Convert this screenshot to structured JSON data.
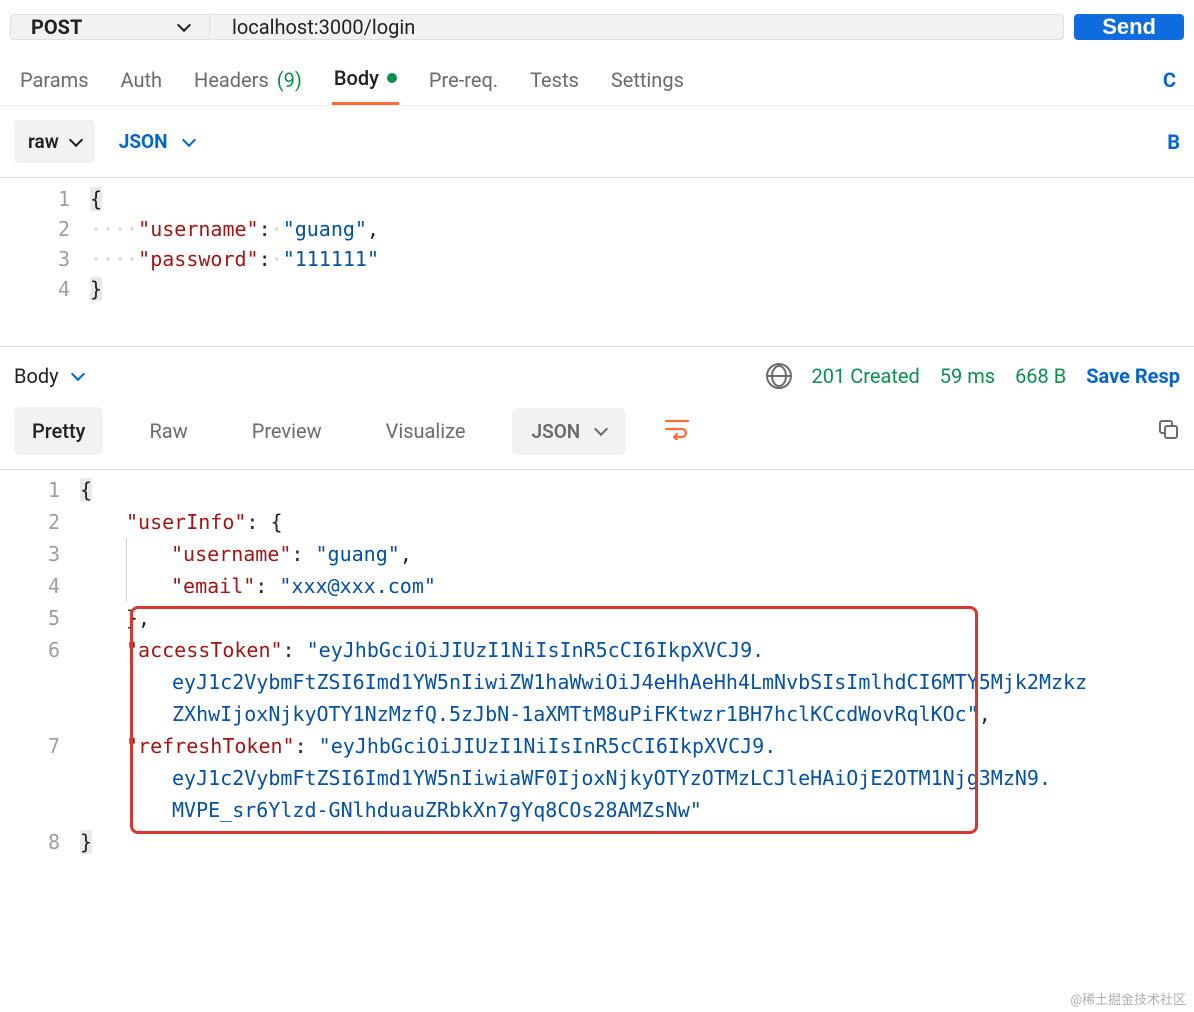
{
  "request": {
    "method": "POST",
    "url": "localhost:3000/login",
    "send_label": "Send"
  },
  "tabs": {
    "params": "Params",
    "auth": "Auth",
    "headers": "Headers",
    "headers_count": "(9)",
    "body": "Body",
    "prerequest": "Pre-req.",
    "tests": "Tests",
    "settings": "Settings",
    "right_link": "C"
  },
  "body_settings": {
    "mode": "raw",
    "content_type": "JSON",
    "right_link": "B"
  },
  "request_body_lines": [
    {
      "n": "1",
      "tokens": [
        {
          "t": "brace",
          "v": "{"
        }
      ]
    },
    {
      "n": "2",
      "tokens": [
        {
          "t": "ws",
          "v": "····"
        },
        {
          "t": "key",
          "v": "\"username\""
        },
        {
          "t": "punct",
          "v": ":"
        },
        {
          "t": "ws",
          "v": "·"
        },
        {
          "t": "str",
          "v": "\"guang\""
        },
        {
          "t": "punct",
          "v": ","
        }
      ]
    },
    {
      "n": "3",
      "tokens": [
        {
          "t": "ws",
          "v": "····"
        },
        {
          "t": "key",
          "v": "\"password\""
        },
        {
          "t": "punct",
          "v": ":"
        },
        {
          "t": "ws",
          "v": "·"
        },
        {
          "t": "str",
          "v": "\"111111\""
        }
      ]
    },
    {
      "n": "4",
      "tokens": [
        {
          "t": "brace",
          "v": "}"
        }
      ]
    }
  ],
  "response": {
    "tab_label": "Body",
    "status": "201 Created",
    "time": "59 ms",
    "size": "668 B",
    "save_label": "Save Resp"
  },
  "viewmodes": {
    "pretty": "Pretty",
    "raw": "Raw",
    "preview": "Preview",
    "visualize": "Visualize",
    "content_type": "JSON"
  },
  "response_lines": [
    {
      "n": "1",
      "html": "<span class='tok-brace'>{</span>"
    },
    {
      "n": "2",
      "html": "<span class='indent1'></span><span class='tok-key'>\"userInfo\"</span><span class='tok-punct'>: {</span>"
    },
    {
      "n": "3",
      "html": "<span class='indent1'></span><span class='fold-line'><span class='tok-key'>\"username\"</span><span class='tok-punct'>: </span><span class='tok-str'>\"guang\"</span><span class='tok-punct'>,</span></span>"
    },
    {
      "n": "4",
      "html": "<span class='indent1'></span><span class='fold-line'><span class='tok-key'>\"email\"</span><span class='tok-punct'>: </span><span class='tok-str'>\"xxx@xxx.com\"</span></span>"
    },
    {
      "n": "5",
      "html": "<span class='indent1'></span><span class='tok-punct'>},</span>"
    },
    {
      "n": "6",
      "html": "<span class='indent1'></span><span class='tok-key'>\"accessToken\"</span><span class='tok-punct'>: </span><span class='tok-str'>\"eyJhbGciOiJIUzI1NiIsInR5cCI6IkpXVCJ9.<br><span class='cont'></span>eyJ1c2VybmFtZSI6Imd1YW5nIiwiZW1haWwiOiJ4eHhAeHh4LmNvbSIsImlhdCI6MTY5Mjk2Mzkz<br><span class='cont'></span>ZXhwIjoxNjkyOTY1NzMzfQ.5zJbN-1aXMTtM8uPiFKtwzr1BH7hclKCcdWovRqlKOc\"</span><span class='tok-punct'>,</span>"
    },
    {
      "n": "7",
      "html": "<span class='indent1'></span><span class='tok-key'>\"refreshToken\"</span><span class='tok-punct'>: </span><span class='tok-str'>\"eyJhbGciOiJIUzI1NiIsInR5cCI6IkpXVCJ9.<br><span class='cont'></span>eyJ1c2VybmFtZSI6Imd1YW5nIiwiaWF0IjoxNjkyOTYzOTMzLCJleHAiOjE2OTM1Njg3MzN9.<br><span class='cont'></span>MVPE_sr6Ylzd-GNlhduauZRbkXn7gYq8COs28AMZsNw\"</span>"
    },
    {
      "n": "8",
      "html": "<span class='tok-brace'>}</span>"
    }
  ],
  "watermark": "@稀土掘金技术社区"
}
